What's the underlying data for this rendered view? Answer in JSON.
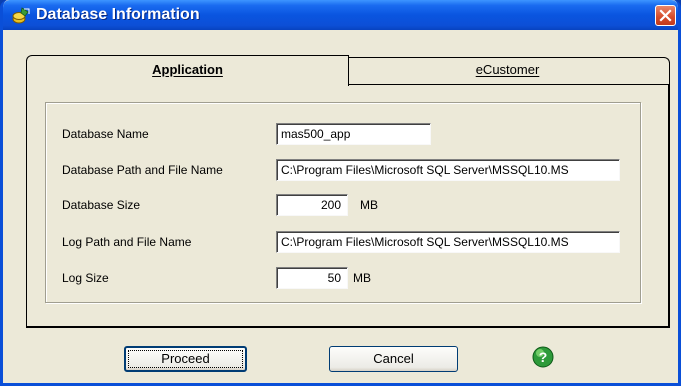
{
  "window": {
    "title": "Database Information",
    "icon": "database-icon",
    "close_icon": "close-icon"
  },
  "tabs": [
    {
      "label": "Application",
      "selected": true
    },
    {
      "label": "eCustomer",
      "selected": false
    }
  ],
  "form": {
    "database_name": {
      "label": "Database Name",
      "value": "mas500_app"
    },
    "database_path": {
      "label": "Database Path and File Name",
      "value": "C:\\Program Files\\Microsoft SQL Server\\MSSQL10.MS"
    },
    "database_size": {
      "label": "Database Size",
      "value": "200",
      "unit": "MB"
    },
    "log_path": {
      "label": "Log Path and File Name",
      "value": "C:\\Program Files\\Microsoft SQL Server\\MSSQL10.MS"
    },
    "log_size": {
      "label": "Log Size",
      "value": "50",
      "unit": "MB"
    }
  },
  "buttons": {
    "proceed": "Proceed",
    "cancel": "Cancel",
    "help_icon": "help-icon"
  },
  "colors": {
    "titlebar": "#0a55e0",
    "dialog_bg": "#ece9d8",
    "help_green": "#2e9a3a"
  }
}
